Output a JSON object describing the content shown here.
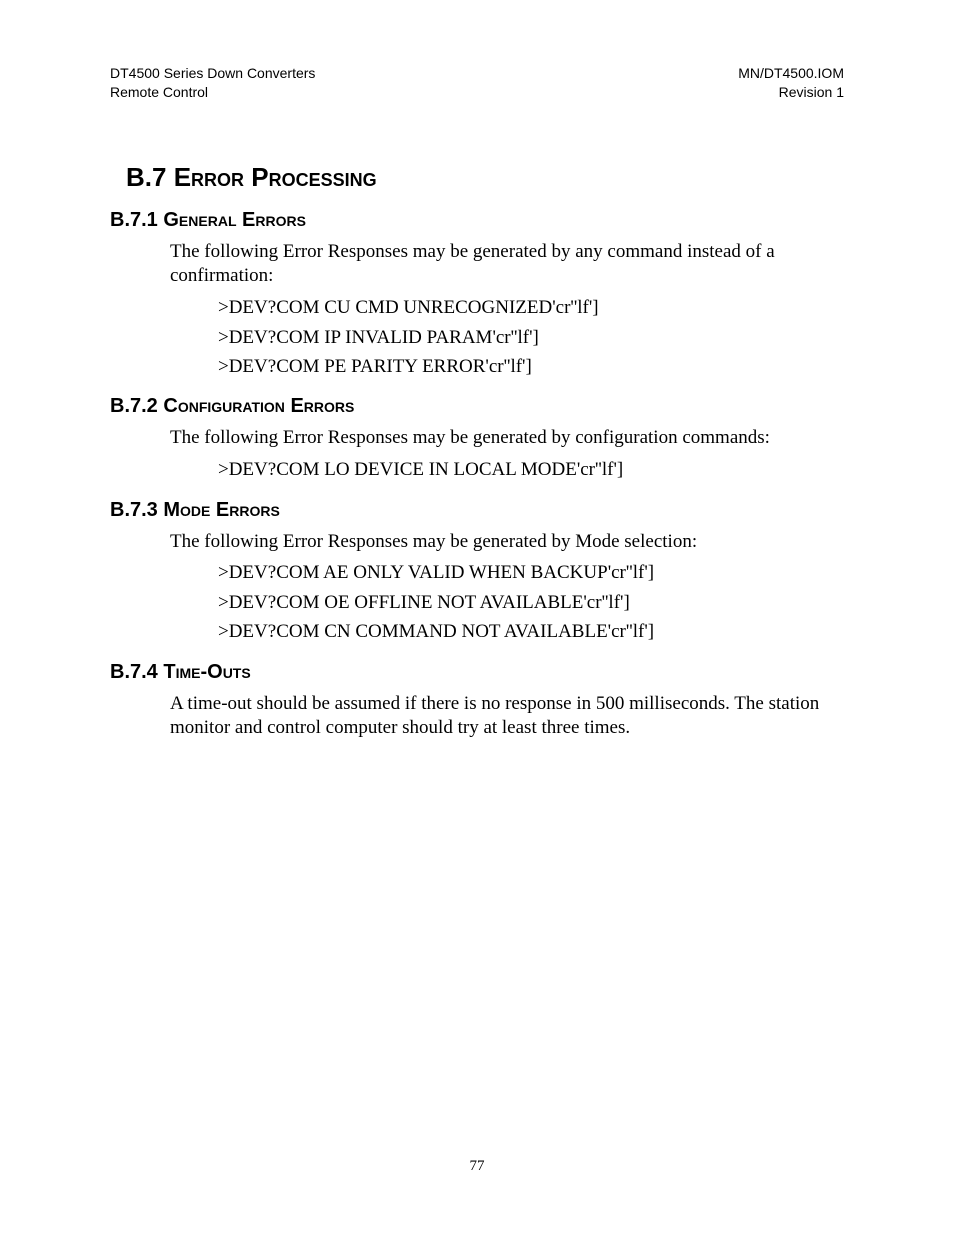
{
  "header": {
    "left_line1": "DT4500 Series Down Converters",
    "left_line2": "Remote Control",
    "right_line1": "MN/DT4500.IOM",
    "right_line2": "Revision 1"
  },
  "main_heading": {
    "number": "B.7",
    "title": "Error Processing"
  },
  "sections": {
    "s1": {
      "number": "B.7.1",
      "title": "General Errors",
      "intro": "The following Error Responses may be generated by any command instead of a confirmation:",
      "lines": [
        ">DEV?COM CU CMD UNRECOGNIZED'cr''lf']",
        ">DEV?COM IP INVALID PARAM'cr''lf']",
        ">DEV?COM PE PARITY ERROR'cr''lf']"
      ]
    },
    "s2": {
      "number": "B.7.2",
      "title": "Configuration Errors",
      "intro": "The following Error Responses may be generated by configuration commands:",
      "lines": [
        ">DEV?COM LO DEVICE IN LOCAL MODE'cr''lf']"
      ]
    },
    "s3": {
      "number": "B.7.3",
      "title": "Mode Errors",
      "intro": "The following Error Responses may be generated by Mode selection:",
      "lines": [
        ">DEV?COM AE ONLY VALID WHEN BACKUP'cr''lf']",
        ">DEV?COM OE OFFLINE NOT AVAILABLE'cr''lf']",
        ">DEV?COM CN COMMAND NOT AVAILABLE'cr''lf']"
      ]
    },
    "s4": {
      "number": "B.7.4",
      "title": "Time-Outs",
      "intro": "A time-out should be assumed if there is no response in 500 milliseconds.  The station monitor and control computer should try at least three times."
    }
  },
  "page_number": "77"
}
